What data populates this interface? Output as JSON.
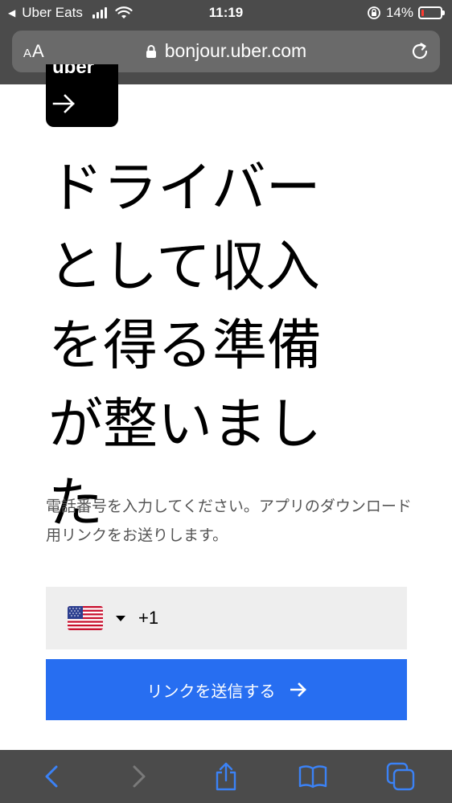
{
  "status_bar": {
    "back_app": "Uber Eats",
    "time": "11:19",
    "battery": "14%",
    "battery_level": 0.14
  },
  "browser": {
    "text_size_small": "A",
    "text_size_large": "A",
    "url": "bonjour.uber.com"
  },
  "logo": {
    "word": "uber"
  },
  "hero": {
    "title_lines": [
      "ドライバー",
      "として収入",
      "を得る準備",
      "が整いまし",
      "た"
    ]
  },
  "description": "電話番号を入力してください。アプリのダウンロード用リンクをお送りします。",
  "phone": {
    "country": "US",
    "country_code": "+1",
    "value": ""
  },
  "send_button": {
    "label": "リンクを送信する"
  },
  "colors": {
    "accent": "#276ef1",
    "chrome": "#4b4b4b",
    "toolbar_icon_active": "#3b82f6",
    "toolbar_icon_disabled": "#7a7a7a"
  },
  "toolbar": {
    "icons": [
      "chevron-left-icon",
      "chevron-right-icon",
      "share-icon",
      "bookmarks-icon",
      "tabs-icon"
    ]
  }
}
